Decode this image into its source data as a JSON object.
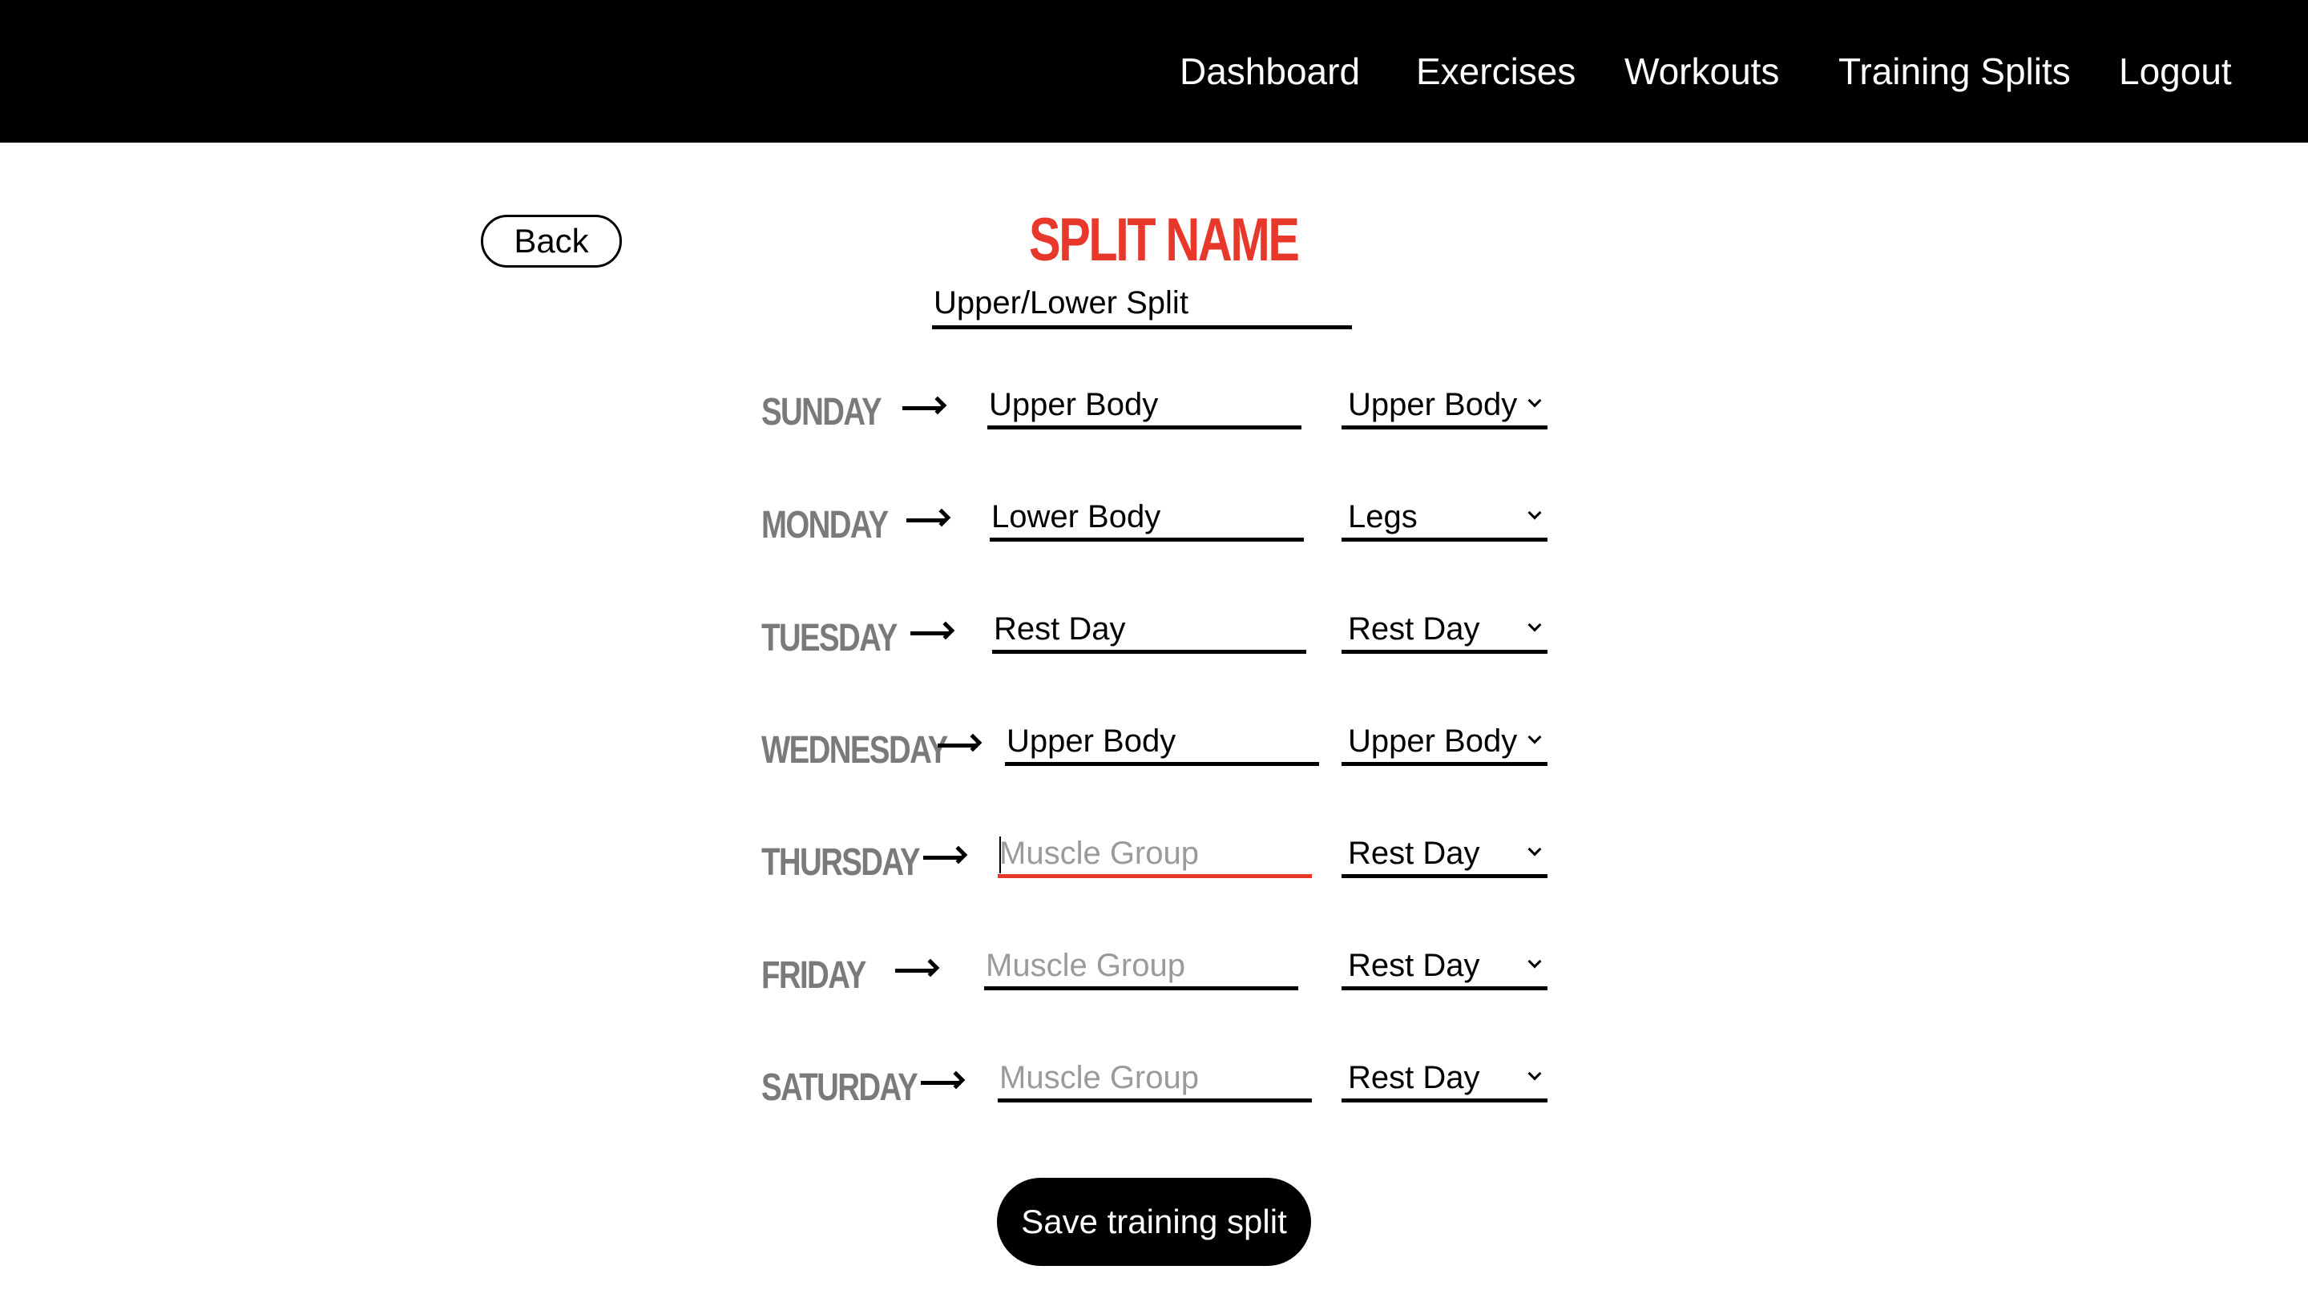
{
  "nav": {
    "links": [
      "Dashboard",
      "Exercises",
      "Workouts",
      "Training Splits",
      "Logout"
    ]
  },
  "back_label": "Back",
  "title": "SPLIT NAME",
  "split_name_value": "Upper/Lower Split",
  "colors": {
    "accent": "#e8382b",
    "nav_bg": "#000000",
    "day_label": "#7a7a7a"
  },
  "days": [
    {
      "day": "SUNDAY",
      "group": "Upper Body",
      "placeholder": "Muscle Group",
      "select": "Upper Body"
    },
    {
      "day": "MONDAY",
      "group": "Lower Body",
      "placeholder": "Muscle Group",
      "select": "Legs"
    },
    {
      "day": "TUESDAY",
      "group": "Rest Day",
      "placeholder": "Muscle Group",
      "select": "Rest Day"
    },
    {
      "day": "WEDNESDAY",
      "group": "Upper Body",
      "placeholder": "Muscle Group",
      "select": "Upper Body"
    },
    {
      "day": "THURSDAY",
      "group": "",
      "placeholder": "Muscle Group",
      "select": "Rest Day"
    },
    {
      "day": "FRIDAY",
      "group": "",
      "placeholder": "Muscle Group",
      "select": "Rest Day"
    },
    {
      "day": "SATURDAY",
      "group": "",
      "placeholder": "Muscle Group",
      "select": "Rest Day"
    }
  ],
  "save_label": "Save training split"
}
